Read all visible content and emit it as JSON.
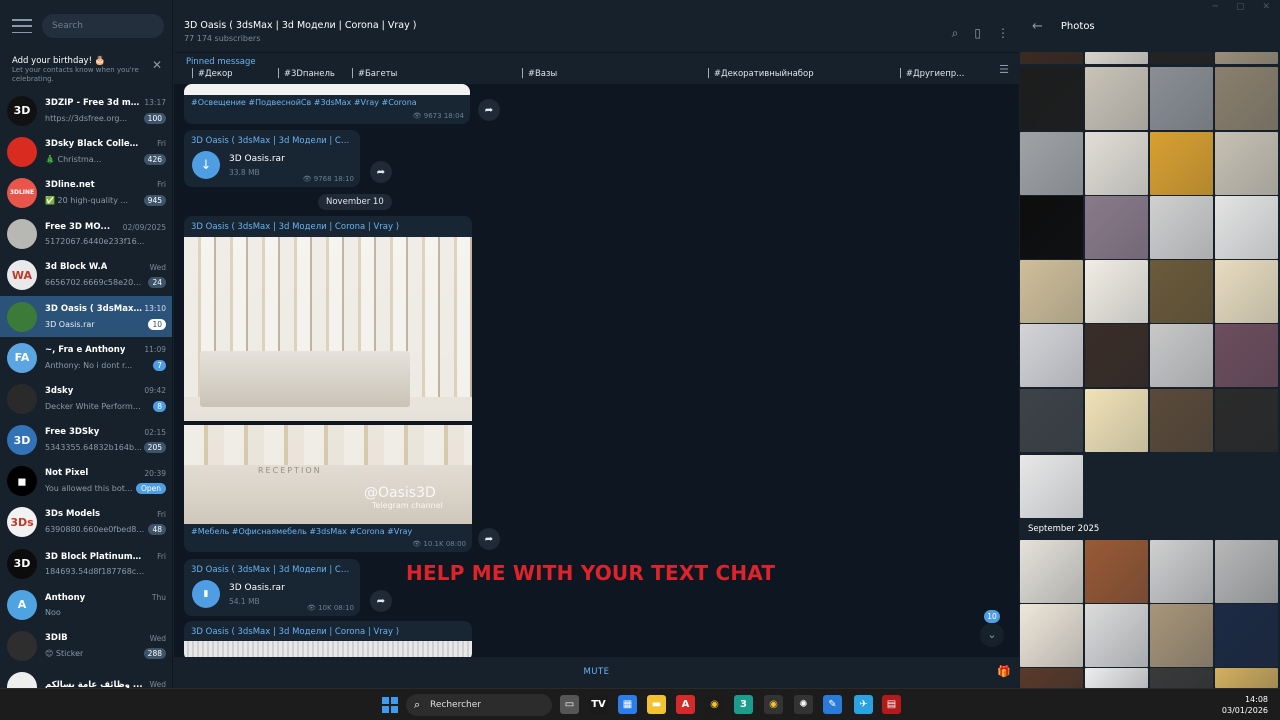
{
  "sidebar": {
    "search_placeholder": "Search",
    "birthday": {
      "title": "Add your birthday! 🎂",
      "subtitle": "Let your contacts know when you're celebrating."
    },
    "chats": [
      {
        "name": "3DZIP - Free 3d mo...",
        "time": "13:17",
        "preview": "https://3dsfree.org...",
        "badge": "100",
        "avatar_text": "3D",
        "avatar_color": "#111111"
      },
      {
        "name": "3Dsky Black Collectio...",
        "time": "Fri",
        "preview": "🎄 Christma...",
        "badge": "426",
        "avatar_text": "",
        "avatar_color": "#d92b20"
      },
      {
        "name": "3Dline.net",
        "time": "Fri",
        "preview": "✅ 20 high-quality ...",
        "badge": "945",
        "avatar_text": "3DLINE",
        "avatar_color": "#e8554a"
      },
      {
        "name": "Free 3D MO...",
        "time": "02/09/2025",
        "preview": "5172067.6440e233f16...",
        "badge": "",
        "avatar_text": "",
        "avatar_color": "#b7b8b3"
      },
      {
        "name": "3d Block W.A",
        "time": "Wed",
        "preview": "6656702.6669c58e20cd0...",
        "badge": "24",
        "avatar_text": "WA",
        "avatar_color": "#e9e9ec"
      },
      {
        "name": "3D Oasis ( 3dsMax ...",
        "time": "13:10",
        "preview": "3D Oasis.rar",
        "badge": "10",
        "avatar_text": "",
        "avatar_color": "#3c7a3a",
        "active": true
      },
      {
        "name": "~, Fra e Anthony",
        "time": "11:09",
        "preview": "Anthony: No i dont r...",
        "badge": "7",
        "avatar_text": "FA",
        "avatar_color": "#5aa5e2"
      },
      {
        "name": "3dsky",
        "time": "09:42",
        "preview": "Decker White Performan...",
        "badge": "8",
        "avatar_text": "",
        "avatar_color": "#2a2a2a"
      },
      {
        "name": "Free 3DSky",
        "time": "02:15",
        "preview": "5343355.64832b164ba...",
        "badge": "205",
        "avatar_text": "3D",
        "avatar_color": "#3273b8"
      },
      {
        "name": "Not Pixel",
        "time": "20:39",
        "preview": "You allowed this bot...",
        "badge": "Open",
        "avatar_text": "◼",
        "avatar_color": "#000000"
      },
      {
        "name": "3Ds Models",
        "time": "Fri",
        "preview": "6390880.660ee0fbed864...",
        "badge": "48",
        "avatar_text": "3Ds",
        "avatar_color": "#f2f2f2"
      },
      {
        "name": "3D Block Platinum 💎",
        "time": "Fri",
        "preview": "184693.54d8f187768ca.rar",
        "badge": "",
        "avatar_text": "3D",
        "avatar_color": "#0c0c0c"
      },
      {
        "name": "Anthony",
        "time": "Thu",
        "preview": "Noo",
        "badge": "",
        "avatar_text": "A",
        "avatar_color": "#4fa3e0"
      },
      {
        "name": "3DIB",
        "time": "Wed",
        "preview": "😊 Sticker",
        "badge": "288",
        "avatar_text": "",
        "avatar_color": "#2e2e2e"
      },
      {
        "name": "وظائف عامة بسالكم ...",
        "time": "Wed",
        "preview": "",
        "badge": "",
        "avatar_text": "",
        "avatar_color": "#eeeeee"
      }
    ]
  },
  "channel": {
    "title": "3D Oasis ( 3dsMax | 3d Модели | Corona | Vray )",
    "subscribers": "77 174 subscribers",
    "pinned_label": "Pinned message",
    "pinned_tags": [
      "#Декор",
      "#3Dпанель",
      "#Багеты",
      "#Вазы",
      "#Декоративныйнабор",
      "#Другиепр..."
    ],
    "messages": {
      "m1_caption": "#Освещение #ПодвеснойСв #3dsMax #Vray #Corona",
      "m1_views": "9673",
      "m1_time": "18:04",
      "m2_author": "3D Oasis ( 3dsMax | 3d Модели | Cor...",
      "m2_file": "3D Oasis.rar",
      "m2_size": "33.8 MB",
      "m2_views": "9768",
      "m2_time": "18:10",
      "date": "November 10",
      "m3_author": "3D Oasis ( 3dsMax | 3d Модели | Corona | Vray )",
      "m3_watermark": "@Oasis3D",
      "m3_watermark2": "Telegram channel",
      "m3_reception": "RECEPTION",
      "m3_caption": "#Мебель #Офиснаямебель #3dsMax #Corona #Vray",
      "m3_views": "10.1K",
      "m3_time": "08:00",
      "m4_author": "3D Oasis ( 3dsMax | 3d Модели | Cor...",
      "m4_file": "3D Oasis.rar",
      "m4_size": "54.1 MB",
      "m4_views": "10K",
      "m4_time": "08:10",
      "m5_author": "3D Oasis ( 3dsMax | 3d Модели | Corona | Vray )"
    },
    "overlay_text": "HELP ME WITH YOUR TEXT CHAT",
    "unread_count": "10",
    "mute_label": "MUTE"
  },
  "photos_panel": {
    "title": "Photos",
    "section_label": "September 2025"
  },
  "taskbar": {
    "search_label": "Rechercher",
    "time": "14:08",
    "date": "03/01/2026"
  },
  "colors": {
    "accent": "#4f9ee3",
    "active_chat": "#2b5278",
    "overlay_red": "#e0232a",
    "link": "#6ab3f3"
  }
}
